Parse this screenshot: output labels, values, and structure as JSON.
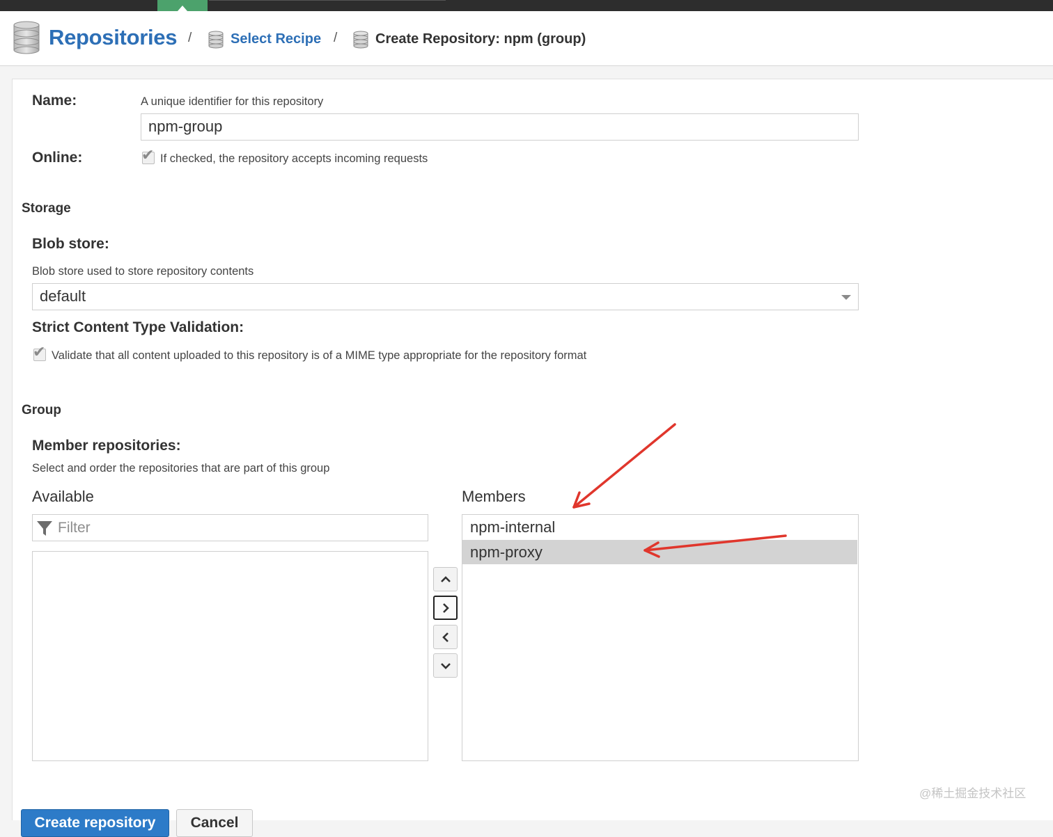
{
  "breadcrumb": {
    "root": "Repositories",
    "separator": "/",
    "recipe": "Select Recipe",
    "current": "Create Repository: npm (group)"
  },
  "form": {
    "name": {
      "label": "Name:",
      "help": "A unique identifier for this repository",
      "value": "npm-group"
    },
    "online": {
      "label": "Online:",
      "help": "If checked, the repository accepts incoming requests",
      "checked": true
    }
  },
  "storage": {
    "section_title": "Storage",
    "blob_store": {
      "label": "Blob store:",
      "help": "Blob store used to store repository contents",
      "value": "default"
    },
    "strict_validation": {
      "label": "Strict Content Type Validation:",
      "help": "Validate that all content uploaded to this repository is of a MIME type appropriate for the repository format",
      "checked": true
    }
  },
  "group": {
    "section_title": "Group",
    "members_label": "Member repositories:",
    "members_help": "Select and order the repositories that are part of this group",
    "available_heading": "Available",
    "members_heading": "Members",
    "filter_placeholder": "Filter",
    "available": [],
    "members": [
      {
        "name": "npm-internal",
        "selected": false
      },
      {
        "name": "npm-proxy",
        "selected": true
      }
    ],
    "order_buttons": [
      {
        "name": "move-up",
        "icon": "chevron-up-icon"
      },
      {
        "name": "add",
        "icon": "chevron-right-icon"
      },
      {
        "name": "remove",
        "icon": "chevron-left-icon"
      },
      {
        "name": "move-down",
        "icon": "chevron-down-icon"
      }
    ]
  },
  "actions": {
    "create": "Create repository",
    "cancel": "Cancel"
  },
  "watermark": "@稀土掘金技术社区",
  "colors": {
    "brand_blue": "#2d6fb6",
    "primary_button": "#2d7bc8",
    "active_tab": "#4ca26c",
    "annotation_arrow": "#e0362c",
    "selected_row": "#d3d3d3"
  }
}
